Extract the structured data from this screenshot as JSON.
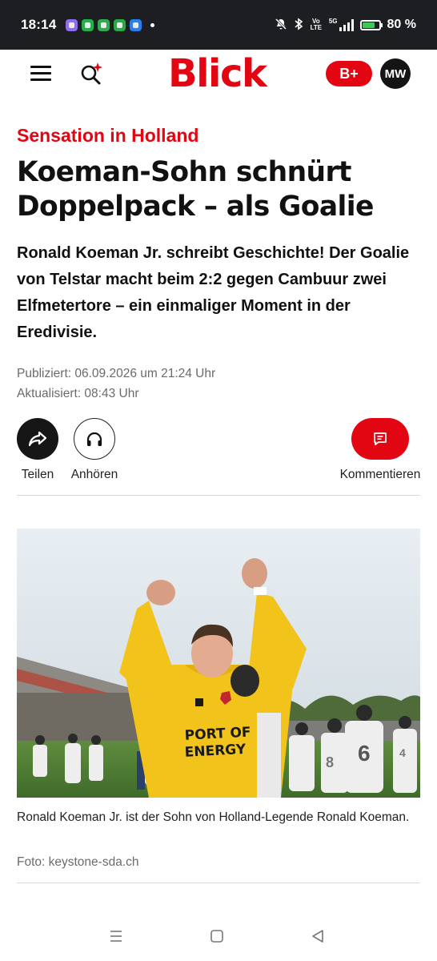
{
  "status_bar": {
    "time": "18:14",
    "network": "5G",
    "volte": "Vo LTE",
    "battery": "80 %",
    "battery_level": 0.8,
    "app_icons": [
      "app-icon-purple",
      "app-icon-green",
      "app-icon-green",
      "shield-icon",
      "key-icon"
    ]
  },
  "header": {
    "logo": "Blick",
    "premium_label": "B+",
    "avatar_initials": "MW"
  },
  "article": {
    "kicker": "Sensation in Holland",
    "headline": "Koeman-Sohn schnürt Doppelpack – als Goalie",
    "lead": "Ronald Koeman Jr. schreibt Geschichte! Der Goalie von Telstar macht beim 2:2 gegen Cambuur zwei Elfmetertore – ein einmaliger Moment in der Eredivisie.",
    "published": "Publiziert: 06.09.2026 um 21:24 Uhr",
    "updated": "Aktualisiert: 08:43 Uhr"
  },
  "actions": {
    "share_label": "Teilen",
    "listen_label": "Anhören",
    "comment_label": "Kommentieren"
  },
  "photo": {
    "jersey_text": "PORT OF ENERGY",
    "caption": "Ronald Koeman Jr. ist der Sohn von Holland-Legende Ronald Koeman.",
    "credit": "Foto: keystone-sda.ch"
  },
  "colors": {
    "brand_red": "#e20613",
    "status_bar_bg": "#1c1e22",
    "jersey_yellow": "#f2c31a"
  }
}
